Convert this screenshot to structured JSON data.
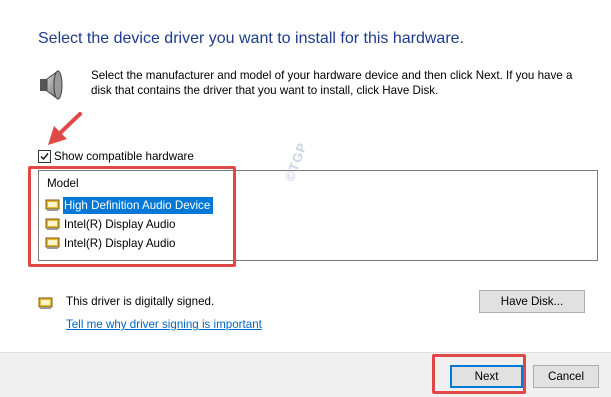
{
  "dialog": {
    "heading": "Select the device driver you want to install for this hardware.",
    "description": "Select the manufacturer and model of your hardware device and then click Next. If you have a disk that contains the driver that you want to install, click Have Disk.",
    "icons": {
      "header": "speaker-icon",
      "driver": "driver-card-icon",
      "signed": "certificate-icon"
    }
  },
  "compatible": {
    "label": "Show compatible hardware",
    "checked": true
  },
  "model_list": {
    "header": "Model",
    "items": [
      {
        "label": "High Definition Audio Device",
        "selected": true
      },
      {
        "label": "Intel(R) Display Audio",
        "selected": false
      },
      {
        "label": "Intel(R) Display Audio",
        "selected": false
      }
    ]
  },
  "watermark": "©TGP",
  "signing": {
    "status": "This driver is digitally signed.",
    "link": "Tell me why driver signing is important"
  },
  "buttons": {
    "have_disk": "Have Disk...",
    "next": "Next",
    "cancel": "Cancel"
  },
  "colors": {
    "heading": "#1e3c8c",
    "selection": "#0078d7",
    "annotation": "#e04848",
    "link": "#0066cc"
  }
}
